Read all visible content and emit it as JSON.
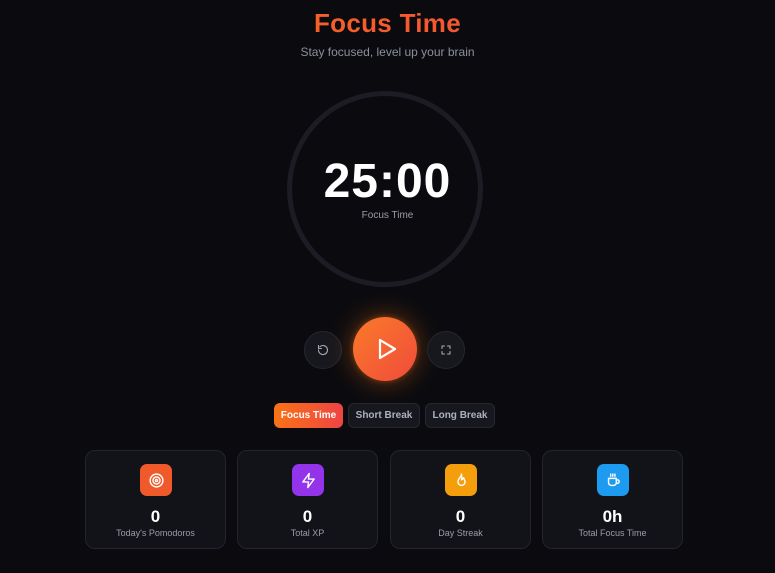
{
  "header": {
    "title": "Focus Time",
    "subtitle": "Stay focused, level up your brain"
  },
  "timer": {
    "time": "25:00",
    "mode_label": "Focus Time"
  },
  "controls": {
    "reset_icon": "reset-icon",
    "play_icon": "play-icon",
    "fullscreen_icon": "fullscreen-icon"
  },
  "modes": [
    {
      "label": "Focus Time",
      "active": true
    },
    {
      "label": "Short Break",
      "active": false
    },
    {
      "label": "Long Break",
      "active": false
    }
  ],
  "stats": [
    {
      "value": "0",
      "label": "Today's Pomodoros",
      "icon": "target-icon",
      "color": "#f05a2a"
    },
    {
      "value": "0",
      "label": "Total XP",
      "icon": "lightning-icon",
      "color": "#9333ea"
    },
    {
      "value": "0",
      "label": "Day Streak",
      "icon": "flame-icon",
      "color": "#f59e0b"
    },
    {
      "value": "0h",
      "label": "Total Focus Time",
      "icon": "coffee-icon",
      "color": "#1d9bf0"
    }
  ],
  "colors": {
    "accent": "#f97316",
    "accent_end": "#ef4444",
    "background": "#0b0b0f"
  }
}
